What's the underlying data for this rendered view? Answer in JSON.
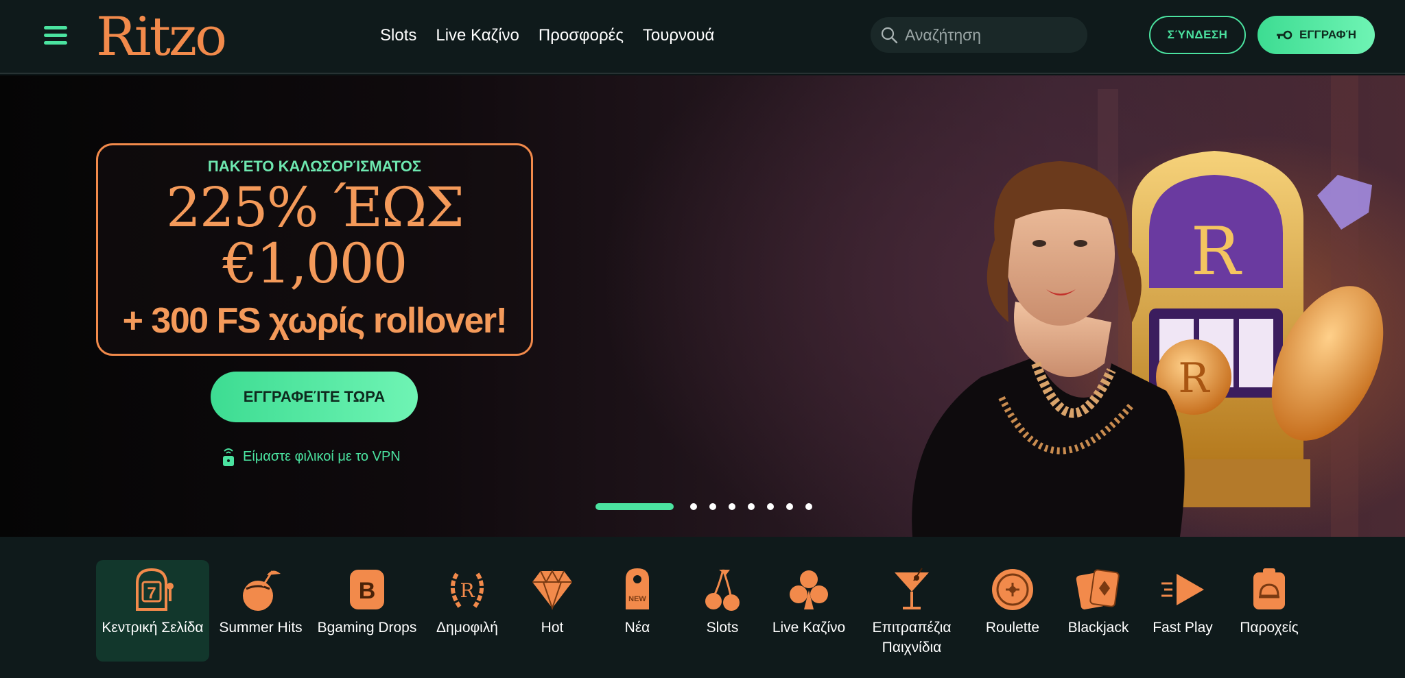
{
  "header": {
    "logo": "Ritzo",
    "nav": [
      "Slots",
      "Live Καζίνο",
      "Προσφορές",
      "Τουρνουά"
    ],
    "search_placeholder": "Αναζήτηση",
    "login_label": "ΣΎΝΔΕΣΗ",
    "register_label": "ΕΓΓΡΑΦΉ"
  },
  "hero": {
    "eyebrow": "ΠΑΚΈΤΟ ΚΑΛΩΣΟΡΊΣΜΑΤΟΣ",
    "line1": "225% ΈΩΣ",
    "line2": "€1,000",
    "line3": "+ 300 FS χωρίς rollover!",
    "cta_label": "ΕΓΓΡΑΦΕΊΤΕ ΤΩΡΑ",
    "vpn_text": "Είμαστε φιλικοί με το VPN",
    "slides_total": 8,
    "active_slide": 1
  },
  "categories": [
    {
      "label": "Κεντρική Σελίδα",
      "icon": "slot-machine-icon",
      "active": true
    },
    {
      "label": "Summer Hits",
      "icon": "coconut-drink-icon"
    },
    {
      "label": "Bgaming Drops",
      "icon": "b-badge-icon"
    },
    {
      "label": "Δημοφιλή",
      "icon": "laurel-crest-icon"
    },
    {
      "label": "Hot",
      "icon": "diamond-icon"
    },
    {
      "label": "Νέα",
      "icon": "door-hanger-new-icon"
    },
    {
      "label": "Slots",
      "icon": "cherries-icon"
    },
    {
      "label": "Live Καζίνο",
      "icon": "club-icon"
    },
    {
      "label": "Επιτραπέζια Παιχνίδια",
      "icon": "cocktail-icon"
    },
    {
      "label": "Roulette",
      "icon": "roulette-icon"
    },
    {
      "label": "Blackjack",
      "icon": "cards-icon"
    },
    {
      "label": "Fast Play",
      "icon": "fast-play-icon"
    },
    {
      "label": "Παροχείς",
      "icon": "provider-bell-icon"
    }
  ],
  "colors": {
    "accent": "#4be3a0",
    "brand": "#f28a4b"
  }
}
